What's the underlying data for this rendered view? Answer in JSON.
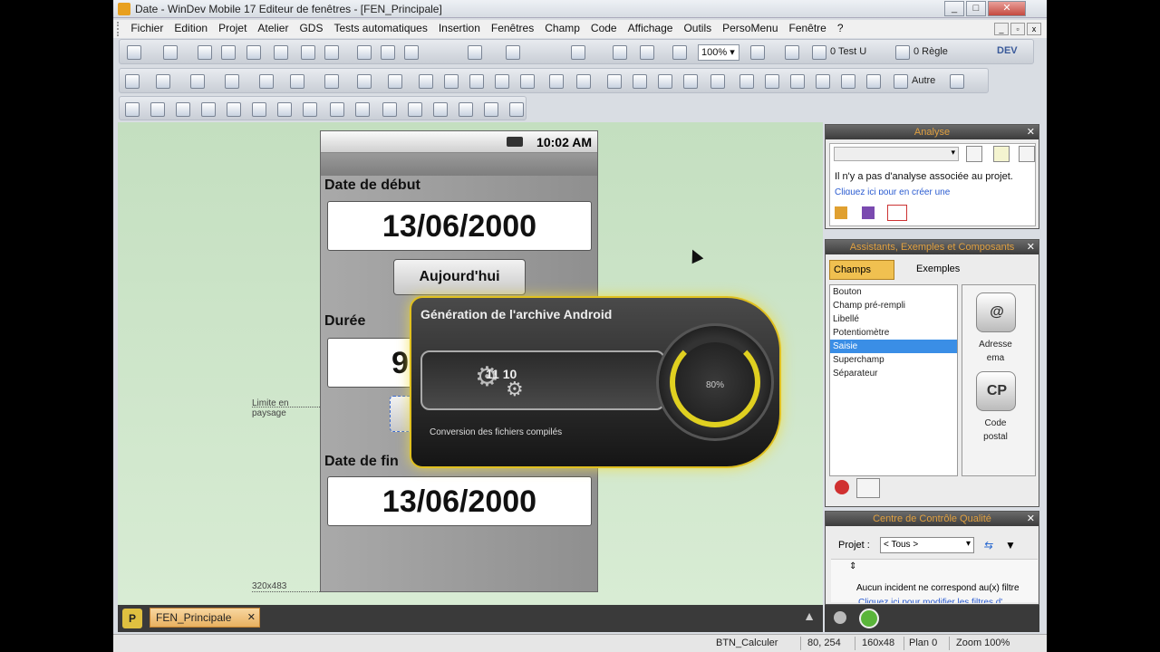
{
  "window": {
    "title": "Date - WinDev Mobile 17  Editeur de fenêtres - [FEN_Principale]",
    "minimize": "_",
    "maximize": "□",
    "close": "✕"
  },
  "menu": [
    "Fichier",
    "Edition",
    "Projet",
    "Atelier",
    "GDS",
    "Tests automatiques",
    "Insertion",
    "Fenêtres",
    "Champ",
    "Code",
    "Affichage",
    "Outils",
    "PersoMenu",
    "Fenêtre",
    "?"
  ],
  "toolbar": {
    "zoom": "100%",
    "test_label": "0 Test U",
    "rule_label": "0 Règle",
    "autre_label": "Autre",
    "logo_text": "DEV"
  },
  "phone": {
    "time": "10:02 AM",
    "label_start": "Date de début",
    "date_start": "13/06/2000",
    "today_button": "Aujourd'hui",
    "label_duration": "Durée",
    "duration_value": "9",
    "label_end": "Date de fin",
    "date_end": "13/06/2000"
  },
  "annotations": {
    "landscape_limit_1": "Limite en",
    "landscape_limit_2": "paysage",
    "size": "320x483"
  },
  "progress": {
    "title": "Génération de l'archive Android",
    "status": "Conversion des fichiers compilés",
    "percent_label": "80%",
    "percent": 80,
    "gear_text": "11 10"
  },
  "tabs": {
    "window_tab": "FEN_Principale",
    "close": "✕",
    "p_icon": "P"
  },
  "analyse": {
    "title": "Analyse",
    "message": "Il n'y a pas d'analyse associée au projet.",
    "link": "Cliquez ici pour en créer une"
  },
  "assistants": {
    "title": "Assistants, Exemples et Composants",
    "tab_champs": "Champs",
    "tab_exemples": "Exemples",
    "items": [
      "Bouton",
      "Champ pré-rempli",
      "Libellé",
      "Potentiomètre",
      "Saisie",
      "Superchamp",
      "Séparateur"
    ],
    "selected_index": 4,
    "icon_items": [
      {
        "label": "Adresse ema",
        "glyph": "@"
      },
      {
        "label": "Code postal",
        "glyph": "CP"
      }
    ]
  },
  "quality": {
    "title": "Centre de Contrôle Qualité",
    "project_label": "Projet :",
    "filter_value": "< Tous >",
    "message": "Aucun incident ne correspond au(x) filtre",
    "link": "Cliquez ici pour modifier les filtres d'"
  },
  "status": {
    "control": "BTN_Calculer",
    "coords": "80, 254",
    "size": "160x48",
    "plan": "Plan 0",
    "zoom": "Zoom 100%"
  }
}
